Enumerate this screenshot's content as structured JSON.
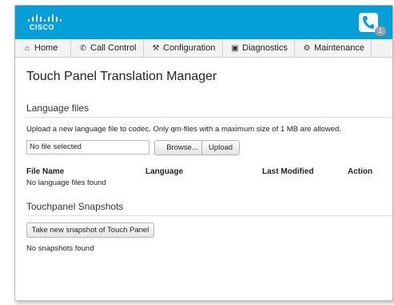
{
  "header": {
    "logo_text": "CISCO",
    "brand_color": "#049fd9",
    "call_badge_count": "1"
  },
  "nav": {
    "tabs": [
      {
        "label": "Home",
        "icon": "home-icon"
      },
      {
        "label": "Call Control",
        "icon": "phone-icon"
      },
      {
        "label": "Configuration",
        "icon": "wrench-icon"
      },
      {
        "label": "Diagnostics",
        "icon": "toolbox-icon"
      },
      {
        "label": "Maintenance",
        "icon": "gear-icon"
      }
    ]
  },
  "main": {
    "title": "Touch Panel Translation Manager",
    "language_files": {
      "heading": "Language files",
      "info": "Upload a new language file to codec. Only qm-files with a maximum size of 1 MB are allowed.",
      "file_input_value": "No file selected",
      "browse_label": "Browse...",
      "upload_label": "Upload",
      "columns": [
        "File Name",
        "Language",
        "Last Modified",
        "Action"
      ],
      "empty_message": "No language files found"
    },
    "snapshots": {
      "heading": "Touchpanel Snapshots",
      "button_label": "Take new snapshot of Touch Panel",
      "empty_message": "No snapshots found"
    }
  }
}
